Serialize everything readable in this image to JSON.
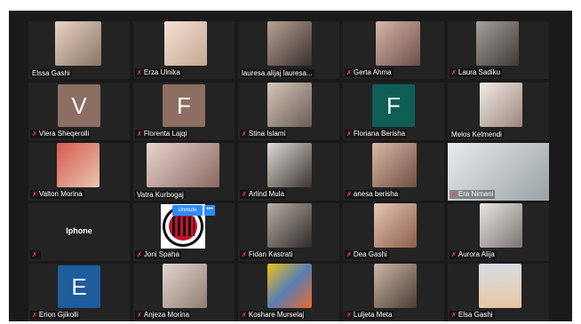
{
  "participants": [
    {
      "name": "Elssa Gashi",
      "muted": false,
      "tone": "#8a7668"
    },
    {
      "name": "Erza Ulnika",
      "muted": true,
      "tone": "#c4a993"
    },
    {
      "name": "lauresa.alijaj lauresa...",
      "muted": false,
      "tone": "#7d695e"
    },
    {
      "name": "Gerta Ahma",
      "muted": true,
      "tone": "#9e7a6b"
    },
    {
      "name": "Laura Sadiku",
      "muted": true,
      "tone": "#6b6259"
    },
    {
      "name": "Vlera Sheqerolli",
      "muted": true,
      "initial": "V"
    },
    {
      "name": "Florenta Lajqi",
      "muted": true,
      "initial": "F"
    },
    {
      "name": "Stina Islami",
      "muted": true,
      "tone": "#9a8a7f"
    },
    {
      "name": "Floriana Berisha",
      "muted": true,
      "initial": "F"
    },
    {
      "name": "Melos Kelmendi",
      "muted": false,
      "tone": "#c9b8ae"
    },
    {
      "name": "Valton Morina",
      "muted": true,
      "tone": "#b9443e"
    },
    {
      "name": "Vatra Kurbogaj",
      "muted": false,
      "tone": "#b89f9a"
    },
    {
      "name": "Arlind Mula",
      "muted": true,
      "tone": "#b5afa8"
    },
    {
      "name": "anesa berisha",
      "muted": true,
      "tone": "#a98a78"
    },
    {
      "name": "Era Nimani",
      "muted": true,
      "tone": "#c8ccce"
    },
    {
      "name": "Iphone",
      "muted": true
    },
    {
      "name": "Joni Spaha",
      "muted": true
    },
    {
      "name": "Fidan Kastrati",
      "muted": true,
      "tone": "#6a5f57"
    },
    {
      "name": "Dea Gashi",
      "muted": true,
      "tone": "#d5b39e"
    },
    {
      "name": "Aurora Alija",
      "muted": true,
      "tone": "#d0cfcf"
    },
    {
      "name": "Erion Gjikolli",
      "muted": true,
      "initial": "E"
    },
    {
      "name": "Anjeza Morina",
      "muted": true,
      "tone": "#b4a79f"
    },
    {
      "name": "Koshare Murselaj",
      "muted": true,
      "tone": "#5a7db5"
    },
    {
      "name": "Luljeta Meta",
      "muted": true,
      "tone": "#7d6a5e"
    },
    {
      "name": "Elsa Gashi",
      "muted": true,
      "tone": "#d7dde6"
    }
  ],
  "hover_controls": {
    "unmute": "Unmute",
    "more": "•••"
  },
  "logo_text": "ACM 1899",
  "colors": {
    "mic_muted": "#ff3b30",
    "button": "#2d8cff",
    "background": "#1a1a1a",
    "tile": "#232323"
  }
}
